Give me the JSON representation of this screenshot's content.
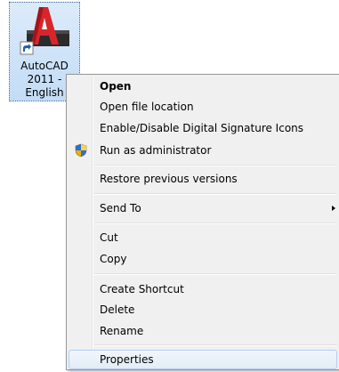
{
  "desktop_icon": {
    "label": "AutoCAD\n2011 -\nEnglish",
    "icon": "autocad-icon",
    "colors": {
      "logo_red": "#d8252c",
      "selection": "#c3dcf6"
    }
  },
  "context_menu": {
    "items": [
      {
        "label": "Open",
        "bold": true
      },
      {
        "label": "Open file location"
      },
      {
        "label": "Enable/Disable Digital Signature Icons"
      },
      {
        "label": "Run as administrator",
        "icon": "shield-icon"
      },
      {
        "label": "Restore previous versions"
      },
      {
        "label": "Send To",
        "submenu_icon": "chevron-right-icon"
      },
      {
        "label": "Cut"
      },
      {
        "label": "Copy"
      },
      {
        "label": "Create Shortcut"
      },
      {
        "label": "Delete"
      },
      {
        "label": "Rename"
      },
      {
        "label": "Properties",
        "highlighted": true
      }
    ]
  }
}
